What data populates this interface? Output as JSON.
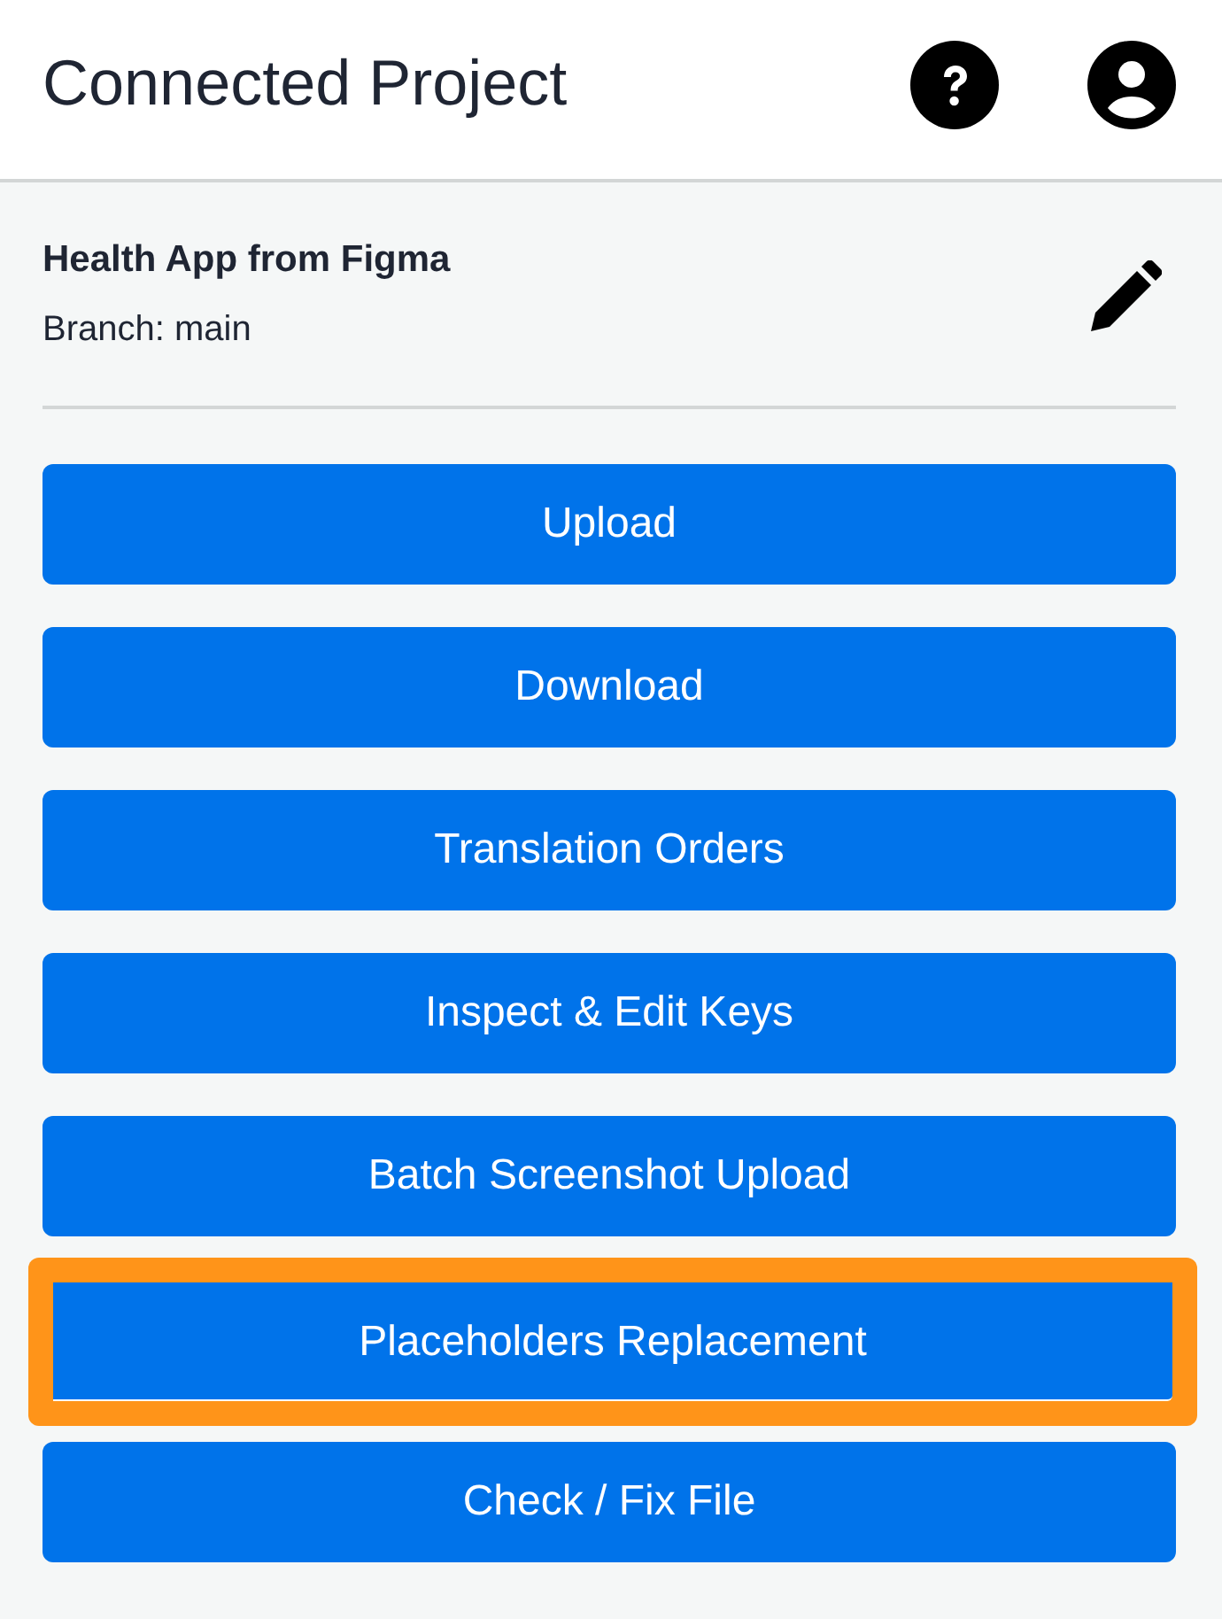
{
  "header": {
    "title": "Connected Project"
  },
  "project": {
    "name": "Health App from Figma",
    "branch": "Branch: main"
  },
  "buttons": [
    {
      "label": "Upload",
      "highlighted": false
    },
    {
      "label": "Download",
      "highlighted": false
    },
    {
      "label": "Translation Orders",
      "highlighted": false
    },
    {
      "label": "Inspect & Edit Keys",
      "highlighted": false
    },
    {
      "label": "Batch Screenshot Upload",
      "highlighted": false
    },
    {
      "label": "Placeholders Replacement",
      "highlighted": true
    },
    {
      "label": "Check / Fix File",
      "highlighted": false
    }
  ]
}
